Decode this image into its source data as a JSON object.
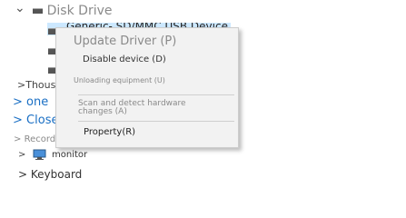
{
  "tree": {
    "disk_drive": {
      "chevron": "⌄",
      "label": "Disk Drive",
      "icon": "drive-icon"
    },
    "selected_device": {
      "label": "Generic- SD/MMC USB Device",
      "icon": "drive-icon"
    },
    "thousand": {
      "chevron": ">",
      "label": "Thousand"
    },
    "one": {
      "chevron": ">",
      "label": "one"
    },
    "close": {
      "chevron": ">",
      "label": "Close"
    },
    "record": {
      "chevron": ">",
      "label": "Record"
    },
    "monitor": {
      "chevron": ">",
      "label": "monitor",
      "icon": "monitor-icon"
    },
    "keyboard": {
      "chevron": ">",
      "label": "Keyboard"
    }
  },
  "context_menu": {
    "update_driver": "Update Driver (P)",
    "disable_device": "Disable device (D)",
    "unloading_equipment": "Unloading equipment (U)",
    "scan_hardware_line1": "Scan and detect hardware",
    "scan_hardware_line2": "changes (A)",
    "property": "Property(R)"
  },
  "colors": {
    "selection": "#cce8ff",
    "link_blue": "#1a6fc4",
    "menu_bg": "#f2f2f2",
    "disabled_text": "#8a8a8a"
  }
}
